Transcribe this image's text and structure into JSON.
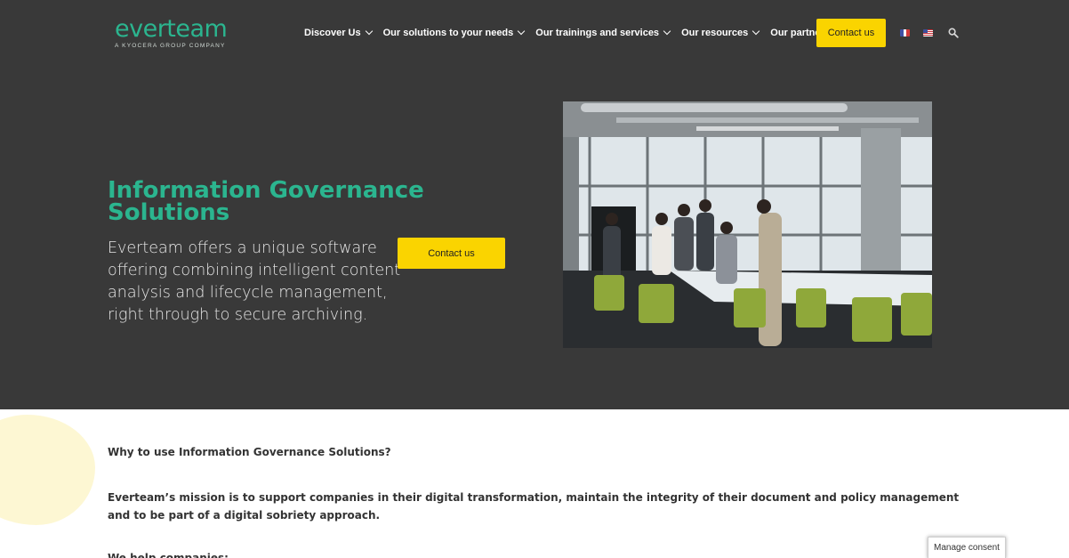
{
  "brand": {
    "name": "everteam",
    "tagline": "A KYOCERA GROUP COMPANY",
    "accent": "#2bb58f",
    "button_color": "#fad400",
    "hero_bg": "#393939"
  },
  "nav": {
    "items": [
      {
        "label": "Discover Us",
        "dropdown": true
      },
      {
        "label": "Our solutions to your needs",
        "dropdown": true
      },
      {
        "label": "Our trainings and services",
        "dropdown": true
      },
      {
        "label": "Our resources",
        "dropdown": true
      },
      {
        "label": "Our partners",
        "dropdown": false
      }
    ],
    "contact_label": "Contact us",
    "languages": [
      "fr-flag-icon",
      "us-flag-icon"
    ],
    "search_icon": "search-icon"
  },
  "hero": {
    "title": "Information Governance Solutions",
    "description": "Everteam offers a unique software offering combining intelligent content analysis and lifecycle management, right through to secure archiving.",
    "cta_label": "Contact us",
    "image": "meeting-photo"
  },
  "content": {
    "question": "Why to use Information Governance Solutions?",
    "mission": "Everteam’s mission is to support companies in their digital transformation, maintain the integrity of their document and policy management and to be part of a digital sobriety approach.",
    "help_intro": "We help companies:"
  },
  "consent": {
    "label": "Manage consent"
  }
}
